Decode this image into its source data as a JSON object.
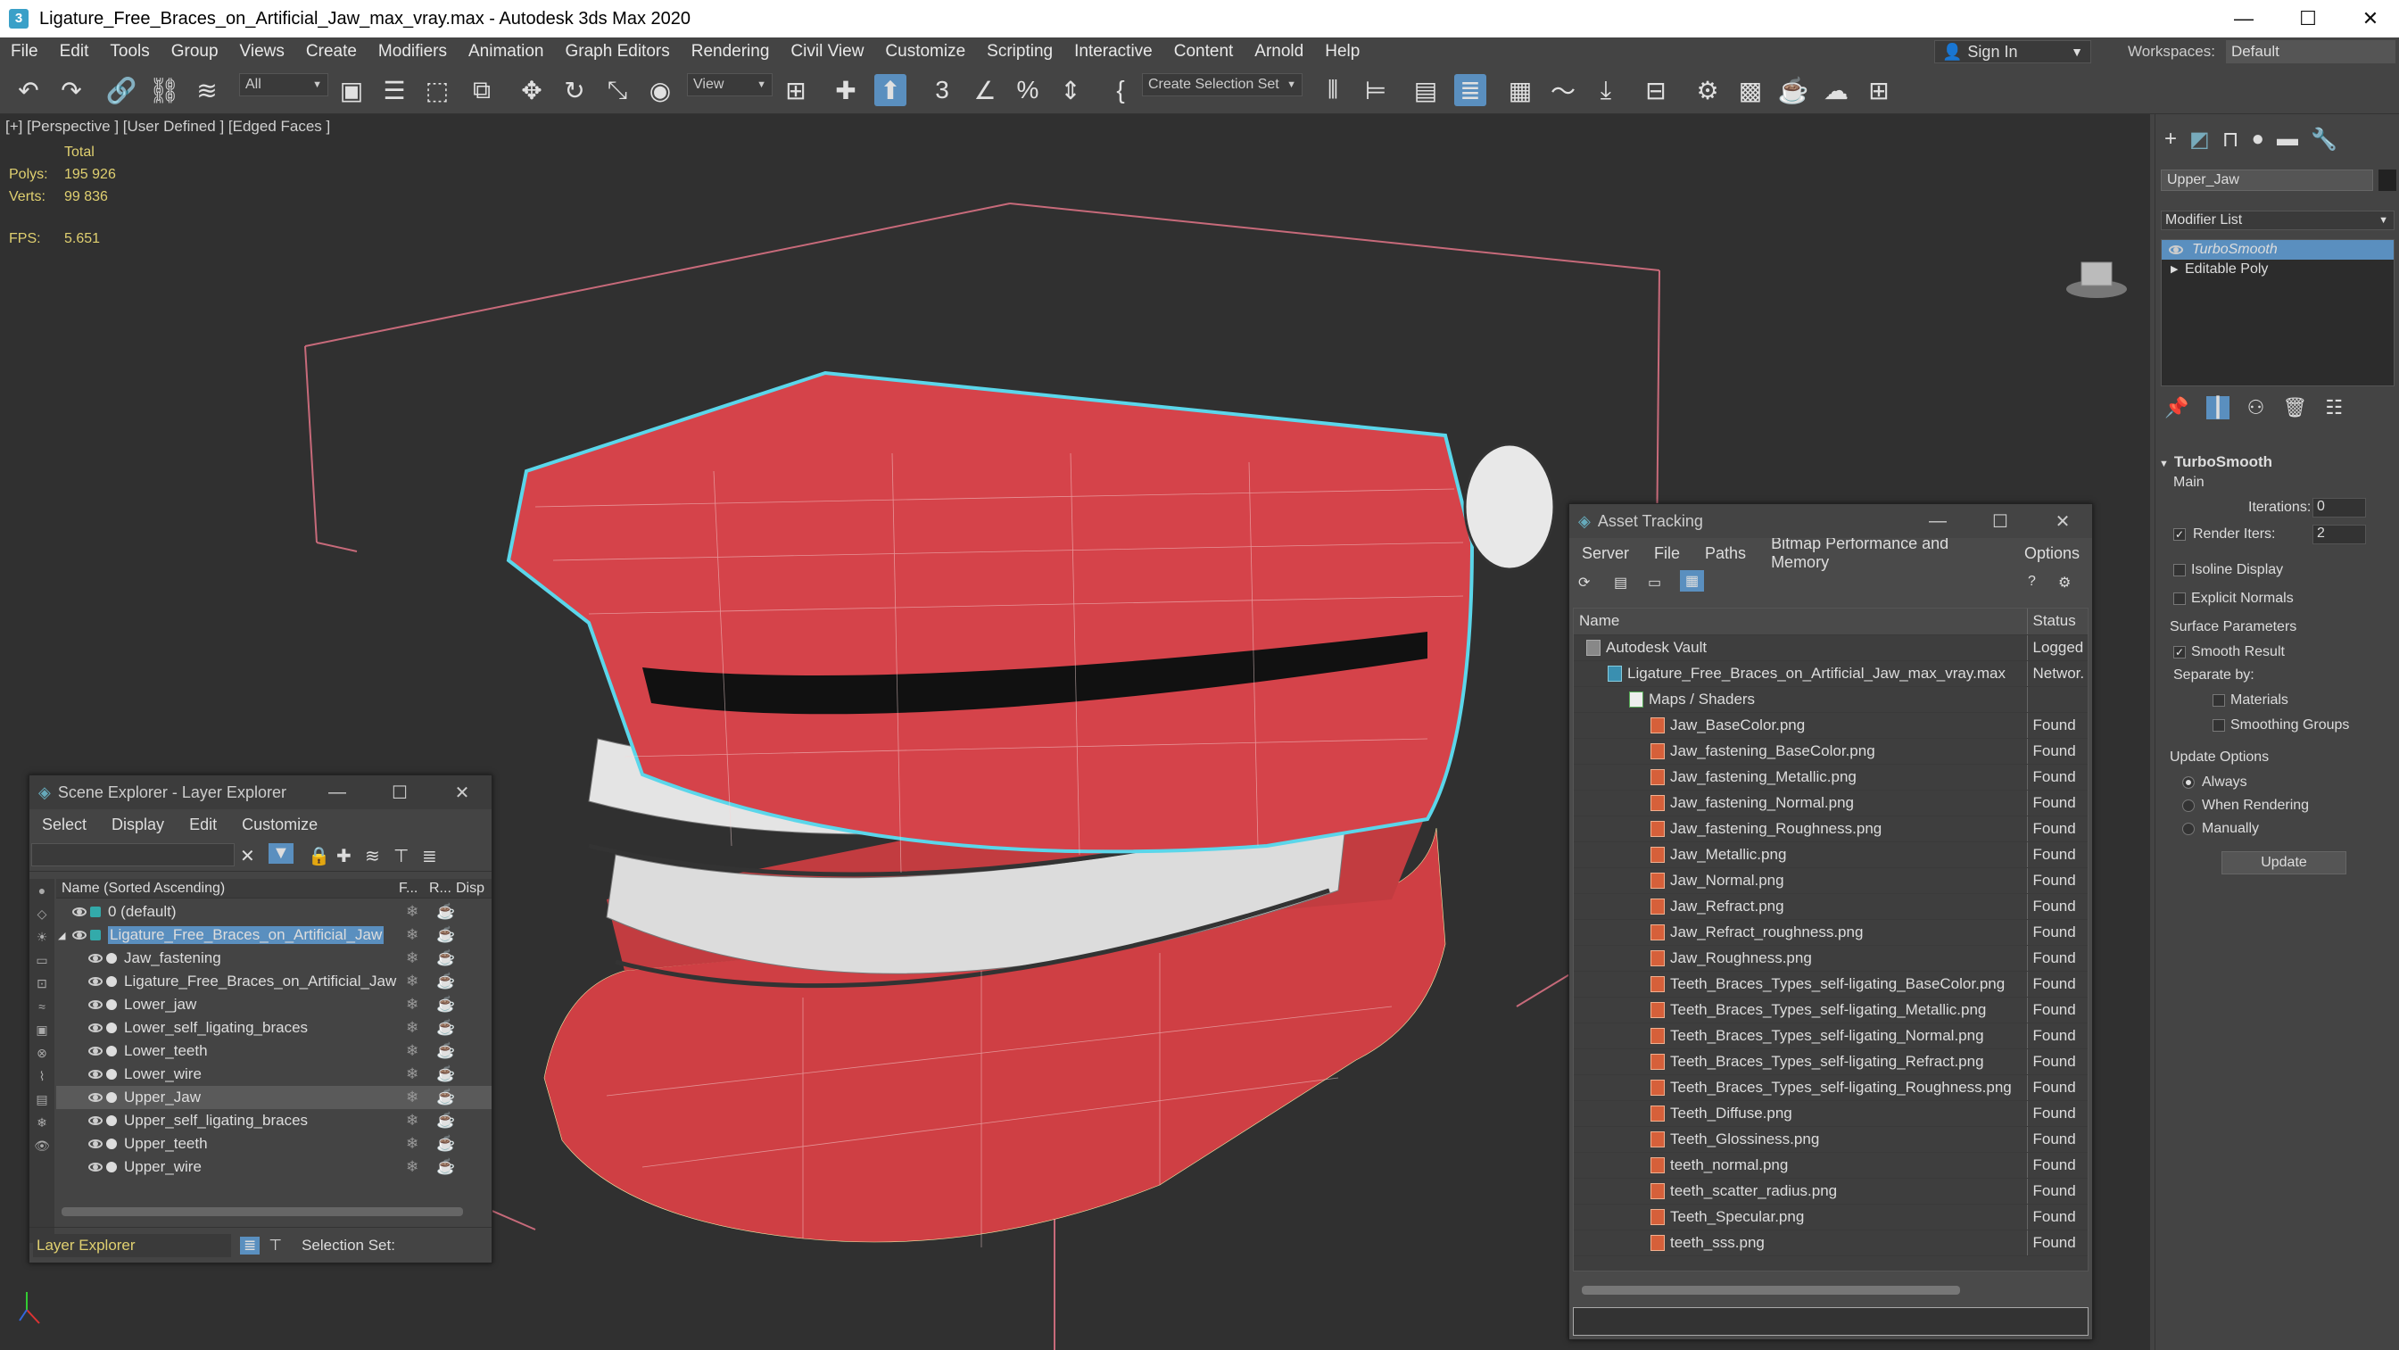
{
  "window": {
    "title": "Ligature_Free_Braces_on_Artificial_Jaw_max_vray.max - Autodesk 3ds Max 2020",
    "app_icon_label": "3"
  },
  "menu": [
    "File",
    "Edit",
    "Tools",
    "Group",
    "Views",
    "Create",
    "Modifiers",
    "Animation",
    "Graph Editors",
    "Rendering",
    "Civil View",
    "Customize",
    "Scripting",
    "Interactive",
    "Content",
    "Arnold",
    "Help"
  ],
  "account": {
    "sign_in": "Sign In",
    "workspaces_label": "Workspaces:",
    "workspace_value": "Default"
  },
  "toolbar": {
    "filter_value": "All",
    "refcoord_value": "View",
    "selection_set_placeholder": "Create Selection Set"
  },
  "viewport": {
    "label": "[+] [Perspective ] [User Defined ] [Edged Faces ]",
    "stats": {
      "total_label": "Total",
      "polys_label": "Polys:",
      "polys": "195 926",
      "verts_label": "Verts:",
      "verts": "99 836",
      "fps_label": "FPS:",
      "fps": "5.651"
    }
  },
  "command_panel": {
    "object_name": "Upper_Jaw",
    "modifier_list_label": "Modifier List",
    "stack": [
      "TurboSmooth",
      "Editable Poly"
    ],
    "rollout_title": "TurboSmooth",
    "main_label": "Main",
    "iterations_label": "Iterations:",
    "iterations": "0",
    "render_iters_label": "Render Iters:",
    "render_iters": "2",
    "isoline": "Isoline Display",
    "explicit": "Explicit Normals",
    "surface_params": "Surface Parameters",
    "smooth_result": "Smooth Result",
    "separate_by": "Separate by:",
    "materials": "Materials",
    "smoothing_groups": "Smoothing Groups",
    "update_options": "Update Options",
    "always": "Always",
    "when_rendering": "When Rendering",
    "manually": "Manually",
    "update_button": "Update"
  },
  "scene_explorer": {
    "title": "Scene Explorer - Layer Explorer",
    "menu": [
      "Select",
      "Display",
      "Edit",
      "Customize"
    ],
    "columns": {
      "name": "Name (Sorted Ascending)",
      "f": "F...",
      "r": "R...",
      "d": "Disp"
    },
    "rows": [
      {
        "label": "0 (default)",
        "indent": 1
      },
      {
        "label": "Ligature_Free_Braces_on_Artificial_Jaw",
        "indent": 1,
        "selected_text": true
      },
      {
        "label": "Jaw_fastening",
        "indent": 2
      },
      {
        "label": "Ligature_Free_Braces_on_Artificial_Jaw",
        "indent": 2
      },
      {
        "label": "Lower_jaw",
        "indent": 2
      },
      {
        "label": "Lower_self_ligating_braces",
        "indent": 2
      },
      {
        "label": "Lower_teeth",
        "indent": 2
      },
      {
        "label": "Lower_wire",
        "indent": 2
      },
      {
        "label": "Upper_Jaw",
        "indent": 2,
        "highlight": true
      },
      {
        "label": "Upper_self_ligating_braces",
        "indent": 2
      },
      {
        "label": "Upper_teeth",
        "indent": 2
      },
      {
        "label": "Upper_wire",
        "indent": 2
      }
    ],
    "footer_mode": "Layer Explorer",
    "selection_set_label": "Selection Set:"
  },
  "asset_tracking": {
    "title": "Asset Tracking",
    "menu": [
      "Server",
      "File",
      "Paths",
      "Bitmap Performance and Memory",
      "Options"
    ],
    "columns": {
      "name": "Name",
      "status": "Status"
    },
    "rows": [
      {
        "name": "Autodesk Vault",
        "status": "Logged",
        "level": 0
      },
      {
        "name": "Ligature_Free_Braces_on_Artificial_Jaw_max_vray.max",
        "status": "Networ.",
        "level": 1
      },
      {
        "name": "Maps / Shaders",
        "status": "",
        "level": 2
      },
      {
        "name": "Jaw_BaseColor.png",
        "status": "Found",
        "level": 3
      },
      {
        "name": "Jaw_fastening_BaseColor.png",
        "status": "Found",
        "level": 3
      },
      {
        "name": "Jaw_fastening_Metallic.png",
        "status": "Found",
        "level": 3
      },
      {
        "name": "Jaw_fastening_Normal.png",
        "status": "Found",
        "level": 3
      },
      {
        "name": "Jaw_fastening_Roughness.png",
        "status": "Found",
        "level": 3
      },
      {
        "name": "Jaw_Metallic.png",
        "status": "Found",
        "level": 3
      },
      {
        "name": "Jaw_Normal.png",
        "status": "Found",
        "level": 3
      },
      {
        "name": "Jaw_Refract.png",
        "status": "Found",
        "level": 3
      },
      {
        "name": "Jaw_Refract_roughness.png",
        "status": "Found",
        "level": 3
      },
      {
        "name": "Jaw_Roughness.png",
        "status": "Found",
        "level": 3
      },
      {
        "name": "Teeth_Braces_Types_self-ligating_BaseColor.png",
        "status": "Found",
        "level": 3
      },
      {
        "name": "Teeth_Braces_Types_self-ligating_Metallic.png",
        "status": "Found",
        "level": 3
      },
      {
        "name": "Teeth_Braces_Types_self-ligating_Normal.png",
        "status": "Found",
        "level": 3
      },
      {
        "name": "Teeth_Braces_Types_self-ligating_Refract.png",
        "status": "Found",
        "level": 3
      },
      {
        "name": "Teeth_Braces_Types_self-ligating_Roughness.png",
        "status": "Found",
        "level": 3
      },
      {
        "name": "Teeth_Diffuse.png",
        "status": "Found",
        "level": 3
      },
      {
        "name": "Teeth_Glossiness.png",
        "status": "Found",
        "level": 3
      },
      {
        "name": "teeth_normal.png",
        "status": "Found",
        "level": 3
      },
      {
        "name": "teeth_scatter_radius.png",
        "status": "Found",
        "level": 3
      },
      {
        "name": "Teeth_Specular.png",
        "status": "Found",
        "level": 3
      },
      {
        "name": "teeth_sss.png",
        "status": "Found",
        "level": 3
      }
    ]
  },
  "colors": {
    "accent": "#5a8fbf",
    "selection": "#5bd6ea",
    "gum": "#d8474a",
    "teeth": "#e6e6e6",
    "stat_text": "#e0d070"
  }
}
